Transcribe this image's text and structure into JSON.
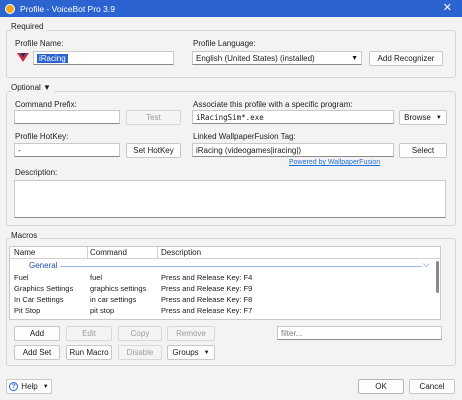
{
  "window": {
    "title": "Profile - VoiceBot Pro 3.9",
    "close_icon": "close-icon"
  },
  "required": {
    "section_label": "Required",
    "profile_name_label": "Profile Name:",
    "profile_name_value": "iRacing",
    "profile_language_label": "Profile Language:",
    "profile_language_value": "English (United States) (installed)",
    "add_recognizer_label": "Add Recognizer"
  },
  "optional": {
    "section_label": "Optional ▼",
    "command_prefix_label": "Command Prefix:",
    "command_prefix_value": "",
    "test_label": "Test",
    "associate_label": "Associate this profile with a specific program:",
    "program_value": "iRacingSim*.exe",
    "browse_label": "Browse",
    "hotkey_label": "Profile HotKey:",
    "hotkey_value": "-",
    "set_hotkey_label": "Set HotKey",
    "wallpaper_label": "Linked WallpaperFusion Tag:",
    "wallpaper_value": "iRacing (videogames|iracing|)",
    "select_label": "Select",
    "powered_by_label": "Powered by WallpaperFusion",
    "description_label": "Description:",
    "description_value": ""
  },
  "macros": {
    "section_label": "Macros",
    "columns": [
      "Name",
      "Command",
      "Description"
    ],
    "group_name": "General",
    "rows": [
      {
        "name": "Fuel",
        "command": "fuel",
        "description": "Press and Release Key: F4"
      },
      {
        "name": "Graphics Settings",
        "command": "graphics settings",
        "description": "Press and Release Key: F9"
      },
      {
        "name": "In Car Settings",
        "command": "in car settings",
        "description": "Press and Release Key: F8"
      },
      {
        "name": "Pit Stop",
        "command": "pit stop",
        "description": "Press and Release Key: F7"
      }
    ],
    "add_label": "Add",
    "edit_label": "Edit",
    "copy_label": "Copy",
    "remove_label": "Remove",
    "filter_placeholder": "filter...",
    "add_set_label": "Add Set",
    "run_macro_label": "Run Macro",
    "disable_label": "Disable",
    "groups_label": "Groups"
  },
  "footer": {
    "help_label": "Help",
    "ok_label": "OK",
    "cancel_label": "Cancel"
  },
  "colors": {
    "titlebar": "#2b64d1",
    "link": "#1f6fd6",
    "selection": "#2b64d1"
  }
}
